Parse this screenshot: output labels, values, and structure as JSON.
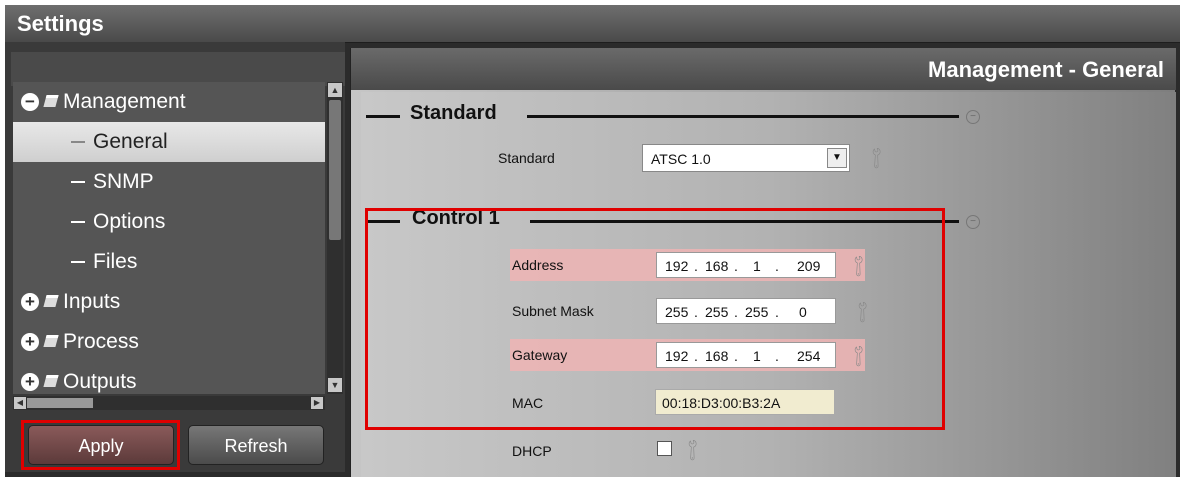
{
  "window": {
    "title": "Settings"
  },
  "tree": {
    "items": [
      {
        "label": "Management",
        "expander": "−",
        "level": 0
      },
      {
        "label": "General",
        "level": 1,
        "selected": true
      },
      {
        "label": "SNMP",
        "level": 1
      },
      {
        "label": "Options",
        "level": 1
      },
      {
        "label": "Files",
        "level": 1
      },
      {
        "label": "Inputs",
        "expander": "+",
        "level": 0
      },
      {
        "label": "Process",
        "expander": "+",
        "level": 0
      },
      {
        "label": "Outputs",
        "expander": "+",
        "level": 0
      }
    ]
  },
  "buttons": {
    "apply": "Apply",
    "refresh": "Refresh"
  },
  "panel": {
    "title": "Management - General"
  },
  "standard_group": {
    "title": "Standard",
    "standard_label": "Standard",
    "standard_value": "ATSC 1.0"
  },
  "control_group": {
    "title": "Control 1",
    "address": {
      "label": "Address",
      "octets": [
        "192",
        "168",
        "1",
        "209"
      ]
    },
    "subnet": {
      "label": "Subnet Mask",
      "octets": [
        "255",
        "255",
        "255",
        "0"
      ]
    },
    "gateway": {
      "label": "Gateway",
      "octets": [
        "192",
        "168",
        "1",
        "254"
      ]
    },
    "mac": {
      "label": "MAC",
      "value": "00:18:D3:00:B3:2A"
    },
    "dhcp": {
      "label": "DHCP",
      "checked": false
    }
  },
  "colors": {
    "highlight": "#e00000",
    "changed_row": "#eeb4b4",
    "mac_field": "#f1ecd0"
  },
  "icons": {
    "collapse": "minus-circle-icon",
    "expand": "plus-circle-icon",
    "wrench": "wrench-icon"
  }
}
